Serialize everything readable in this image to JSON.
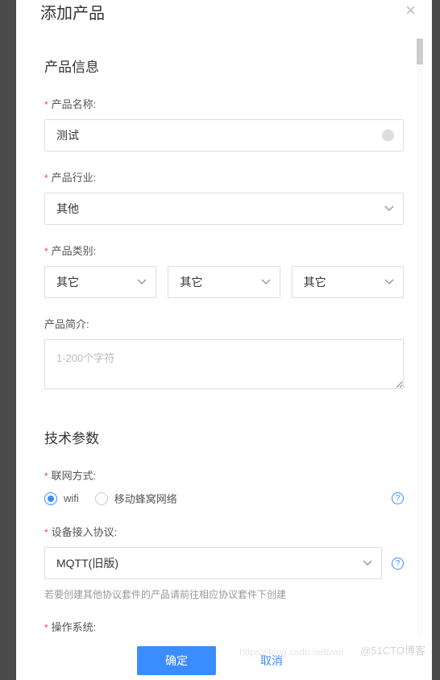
{
  "modal": {
    "title": "添加产品",
    "close": "×"
  },
  "section1": {
    "title": "产品信息",
    "name": {
      "label": "产品名称:",
      "value": "测试"
    },
    "industry": {
      "label": "产品行业:",
      "value": "其他"
    },
    "category": {
      "label": "产品类别:",
      "values": [
        "其它",
        "其它",
        "其它"
      ]
    },
    "intro": {
      "label": "产品简介:",
      "placeholder": "1-200个字符"
    }
  },
  "section2": {
    "title": "技术参数",
    "network": {
      "label": "联网方式:",
      "options": [
        {
          "label": "wifi",
          "checked": true
        },
        {
          "label": "移动蜂窝网络",
          "checked": false
        }
      ]
    },
    "protocol": {
      "label": "设备接入协议:",
      "value": "MQTT(旧版)",
      "hint": "若要创建其他协议套件的产品请前往相应协议套件下创建"
    },
    "os": {
      "label": "操作系统:"
    }
  },
  "footer": {
    "confirm": "确定",
    "cancel": "取消"
  },
  "watermark": "@51CTO博客",
  "watermark2": "https://blog.csdn.net/wei"
}
